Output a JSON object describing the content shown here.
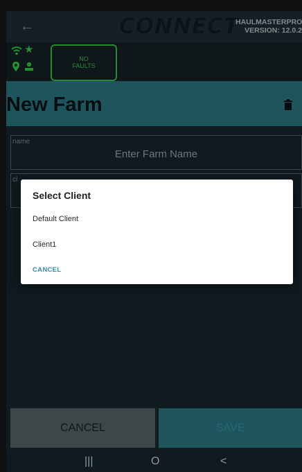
{
  "topbar": {
    "logo": "CONNECT",
    "app_name": "HAULMASTERPRO",
    "version": "VERSION: 12.0.2"
  },
  "status": {
    "faults_line1": "NO",
    "faults_line2": "FAULTS"
  },
  "header": {
    "title": "New Farm"
  },
  "form": {
    "name_label": "name",
    "name_placeholder": "Enter Farm Name",
    "client_label": "cl"
  },
  "buttons": {
    "cancel": "CANCEL",
    "save": "SAVE"
  },
  "dialog": {
    "title": "Select Client",
    "options": [
      "Default Client",
      "Client1"
    ],
    "cancel": "CANCEL"
  },
  "navbar": {
    "recents": "|||",
    "home": "O",
    "back": "<"
  },
  "colors": {
    "accent": "#2f8390",
    "fault_green": "#3cd34c",
    "dialog_link": "#2f8fb3"
  }
}
